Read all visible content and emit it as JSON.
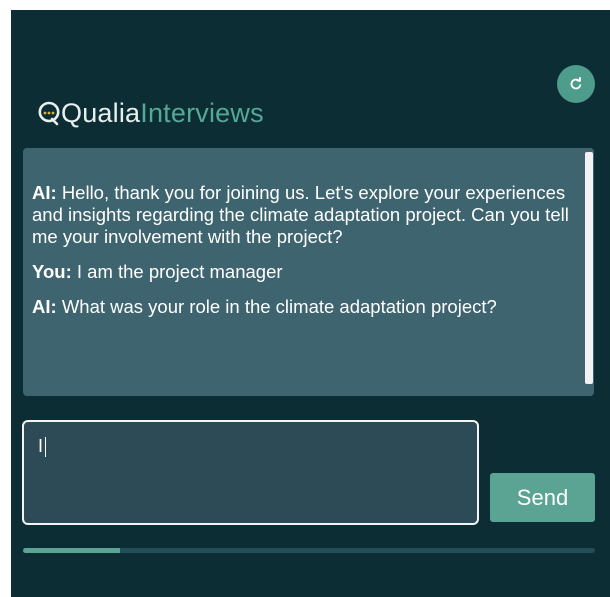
{
  "app": {
    "logo_part1": "Qualia",
    "logo_part2": "Interviews",
    "accent_color": "#5ba393",
    "background_color": "#0d2d34"
  },
  "header": {
    "refresh_icon": "refresh-icon"
  },
  "chat": {
    "messages": [
      {
        "speaker": "AI:",
        "text": "Hello, thank you for joining us. Let's explore your experiences and insights regarding the climate adaptation project. Can you tell me your involvement with the project?"
      },
      {
        "speaker": "You:",
        "text": "I am the project manager"
      },
      {
        "speaker": "AI:",
        "text": "What was your role in the climate adaptation project?"
      }
    ]
  },
  "composer": {
    "input_value": "I",
    "send_label": "Send"
  },
  "progress": {
    "fraction": 0.17
  }
}
